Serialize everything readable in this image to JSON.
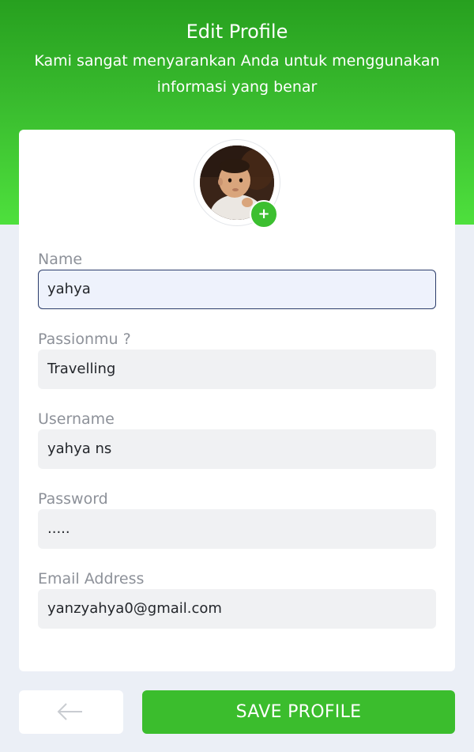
{
  "header": {
    "title": "Edit Profile",
    "subtitle": "Kami sangat menyarankan Anda untuk menggunakan informasi yang benar"
  },
  "avatar": {
    "add_label": "+"
  },
  "form": {
    "fields": [
      {
        "label": "Name",
        "value": "yahya"
      },
      {
        "label": "Passionmu ?",
        "value": "Travelling"
      },
      {
        "label": "Username",
        "value": "yahya ns"
      },
      {
        "label": "Password",
        "value": "....."
      },
      {
        "label": "Email Address",
        "value": "yanzyahya0@gmail.com"
      }
    ]
  },
  "actions": {
    "back_icon": "arrow-left-icon",
    "save_label": "SAVE PROFILE"
  },
  "colors": {
    "accent": "#3bbd2d",
    "background": "#ebeff6",
    "focus_border": "#2c3d6b"
  }
}
